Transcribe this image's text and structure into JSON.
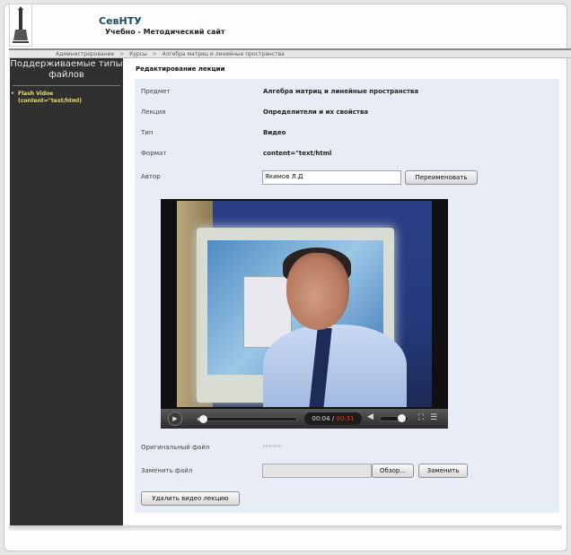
{
  "header": {
    "site_title": "СевНТУ",
    "site_subtitle": "Учебно - Методический сайт"
  },
  "breadcrumb": {
    "items": [
      "Администрирование",
      "Курсы",
      "Алгебра матриц и линейные пространства"
    ],
    "separator": ">"
  },
  "sidebar": {
    "title": "Поддерживаемые типы файлов",
    "items": [
      {
        "label": "Flash Vidoe (content=\"text/html)"
      }
    ]
  },
  "main": {
    "heading": "Редактирование лекции",
    "fields": {
      "subject_label": "Предмет",
      "subject_value": "Алгебра матриц и линейные пространства",
      "lecture_label": "Лекция",
      "lecture_value": "Определители и их свойства",
      "type_label": "Тип",
      "type_value": "Видео",
      "format_label": "Формат",
      "format_value": "content=\"text/html",
      "author_label": "Автор",
      "author_value": "Якимов Л.Д"
    },
    "rename_button": "Переименовать",
    "video_player": {
      "current_time": "00:04",
      "separator": "/",
      "total_time": "00:31",
      "progress": 0.05,
      "volume": 0.75
    },
    "original_file_label": "Оригинальный файл",
    "original_file_link": "скачать",
    "replace_file_label": "Заменить файл",
    "browse_button": "Обзор...",
    "replace_button": "Заменить",
    "delete_button": "Удалить видео лекцию"
  },
  "colors": {
    "sidebar_bg": "#2f302f",
    "sidebar_item": "#e4e06a",
    "panel_bg": "#e7ecf5",
    "title_color": "#1a4c63",
    "time_total": "#e03a2a"
  }
}
